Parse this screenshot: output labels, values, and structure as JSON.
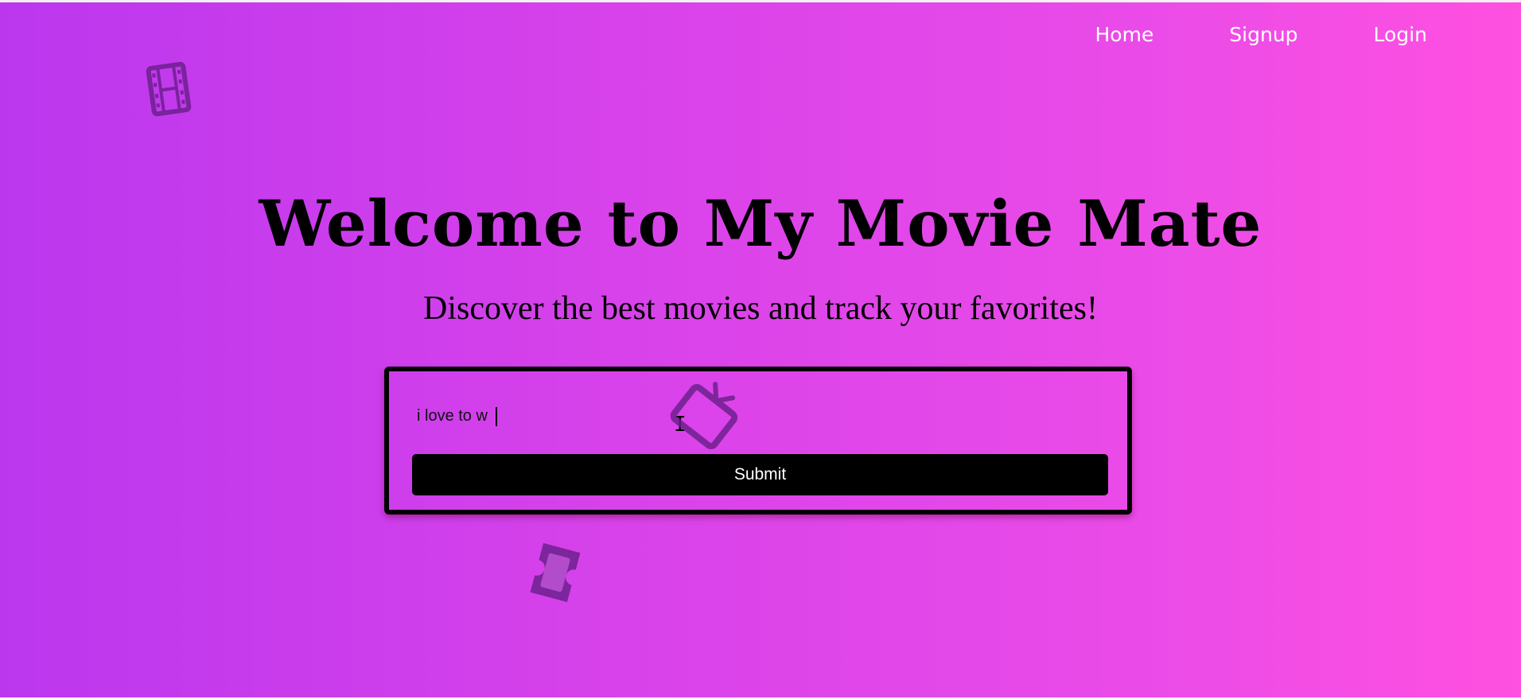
{
  "nav": {
    "links": [
      {
        "label": "Home"
      },
      {
        "label": "Signup"
      },
      {
        "label": "Login"
      }
    ]
  },
  "hero": {
    "title": "Welcome to My Movie Mate",
    "subtitle": "Discover the best movies and track your favorites!"
  },
  "form": {
    "input_value": "i love to w",
    "submit_label": "Submit"
  },
  "decorations": [
    "film-strip-icon",
    "tv-icon",
    "ticket-icon"
  ],
  "colors": {
    "gradient_start": "#bb37ee",
    "gradient_end": "#ff50e0",
    "text": "#000000",
    "nav_text": "#ffffff",
    "button_bg": "#000000",
    "icon": "#6a1f8c"
  }
}
